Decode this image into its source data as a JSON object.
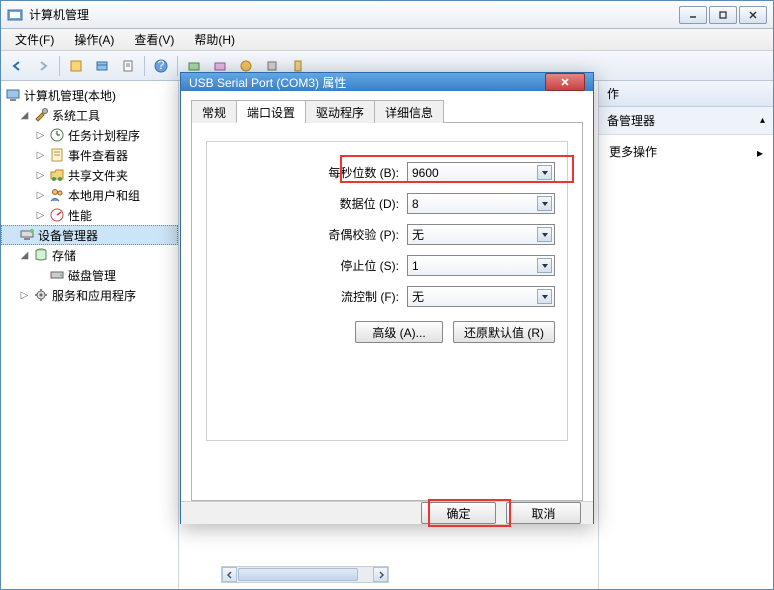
{
  "window": {
    "title": "计算机管理"
  },
  "menu": {
    "file": "文件(F)",
    "action": "操作(A)",
    "view": "查看(V)",
    "help": "帮助(H)"
  },
  "tree": {
    "root": "计算机管理(本地)",
    "system_tools": "系统工具",
    "task_scheduler": "任务计划程序",
    "event_viewer": "事件查看器",
    "shared_folders": "共享文件夹",
    "local_users": "本地用户和组",
    "performance": "性能",
    "device_manager": "设备管理器",
    "storage": "存储",
    "disk_mgmt": "磁盘管理",
    "services": "服务和应用程序"
  },
  "right": {
    "header": "作",
    "subheader": "备管理器",
    "more_actions": "更多操作"
  },
  "dialog": {
    "title": "USB Serial Port (COM3) 属性",
    "tabs": {
      "general": "常规",
      "port": "端口设置",
      "driver": "驱动程序",
      "details": "详细信息"
    },
    "fields": {
      "baud_label": "每秒位数 (B):",
      "baud_value": "9600",
      "databits_label": "数据位 (D):",
      "databits_value": "8",
      "parity_label": "奇偶校验 (P):",
      "parity_value": "无",
      "stopbits_label": "停止位 (S):",
      "stopbits_value": "1",
      "flow_label": "流控制 (F):",
      "flow_value": "无"
    },
    "advanced": "高级 (A)...",
    "restore": "还原默认值 (R)",
    "ok": "确定",
    "cancel": "取消"
  }
}
